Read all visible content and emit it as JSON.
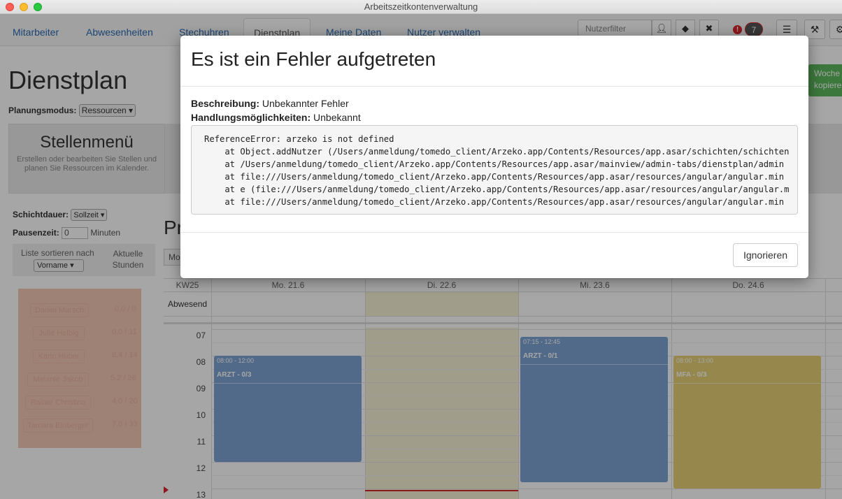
{
  "window": {
    "title": "Arbeitszeitkontenverwaltung"
  },
  "nav": {
    "tabs": [
      "Mitarbeiter",
      "Abwesenheiten",
      "Stechuhren",
      "Dienstplan",
      "Meine Daten",
      "Nutzer verwalten"
    ],
    "active_tab": "Dienstplan",
    "userfilter_placeholder": "Nutzerfilter",
    "alert_count": "7"
  },
  "page": {
    "title": "Dienstplan",
    "planning_mode_label": "Planungsmodus:",
    "planning_mode_value": "Ressourcen",
    "copy_button": "Woche kopieren",
    "stellen_title": "Stellenmenü",
    "stellen_desc": "Erstellen oder bearbeiten Sie Stellen und planen Sie Ressourcen im Kalender.",
    "shift_duration_label": "Schichtdauer:",
    "shift_duration_value": "Sollzeit",
    "pause_label": "Pausenzeit:",
    "pause_value": "0",
    "pause_unit": "Minuten",
    "sort_label": "Liste sortieren nach",
    "sort_value": "Vorname",
    "hours_label": "Aktuelle Stunden",
    "persons": [
      {
        "name": "Daniel Marsch",
        "hours": "0,0 / 0"
      },
      {
        "name": "Julie Helbig",
        "hours": "0,0 / 11"
      },
      {
        "name": "Karin Huber",
        "hours": "8,4 / 14"
      },
      {
        "name": "Melanie Jakob",
        "hours": "5,2 / 26"
      },
      {
        "name": "Rainer Christina",
        "hours": "4,0 / 20"
      },
      {
        "name": "Tamara Elnberger",
        "hours": "7,0 / 33"
      }
    ]
  },
  "calendar": {
    "section_title_partial": "Pr",
    "mode_button_partial": "Mo",
    "week_label": "KW25",
    "days": [
      "Mo. 21.6",
      "Di. 22.6",
      "Mi. 23.6",
      "Do. 24.6"
    ],
    "allday_label": "Abwesend",
    "hours": [
      "07",
      "08",
      "09",
      "10",
      "11",
      "12",
      "13"
    ],
    "events": [
      {
        "time": "08:00 - 12:00",
        "label": "ARZT - 0/3",
        "color": "#7ea4d4"
      },
      {
        "time": "07:15 - 12:45",
        "label": "ARZT - 0/1",
        "color": "#7ea4d4"
      },
      {
        "time": "08:00 - 13:00",
        "label": "MFA - 0/3",
        "color": "#e6d276"
      }
    ]
  },
  "modal": {
    "title": "Es ist ein Fehler aufgetreten",
    "description_label": "Beschreibung:",
    "description_value": "Unbekannter Fehler",
    "actions_label": "Handlungsmöglichkeiten:",
    "actions_value": "Unbekannt",
    "trace": [
      "ReferenceError: arzeko is not defined",
      "    at Object.addNutzer (/Users/anmeldung/tomedo_client/Arzeko.app/Contents/Resources/app.asar/schichten/schichten",
      "    at /Users/anmeldung/tomedo_client/Arzeko.app/Contents/Resources/app.asar/mainview/admin-tabs/dienstplan/admin",
      "    at file:///Users/anmeldung/tomedo_client/Arzeko.app/Contents/Resources/app.asar/resources/angular/angular.min",
      "    at e (file:///Users/anmeldung/tomedo_client/Arzeko.app/Contents/Resources/app.asar/resources/angular/angular.m",
      "    at file:///Users/anmeldung/tomedo_client/Arzeko.app/Contents/Resources/app.asar/resources/angular/angular.min"
    ],
    "ignore_button": "Ignorieren"
  }
}
